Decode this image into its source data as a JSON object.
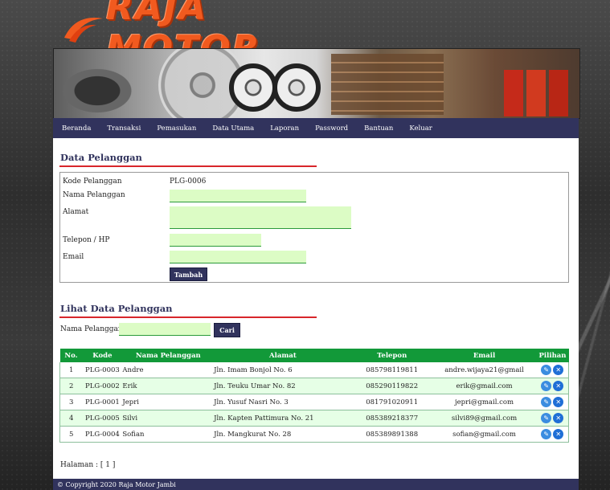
{
  "brand": {
    "logo_text": "RAJA MOTOR",
    "accent": "#f15a1f"
  },
  "nav": {
    "items": [
      "Beranda",
      "Transaksi",
      "Pemasukan",
      "Data Utama",
      "Laporan",
      "Password",
      "Bantuan",
      "Keluar"
    ]
  },
  "form": {
    "title": "Data Pelanggan",
    "kode_label": "Kode Pelanggan",
    "kode_value": "PLG-0006",
    "nama_label": "Nama Pelanggan",
    "nama_value": "",
    "alamat_label": "Alamat",
    "alamat_value": "",
    "telepon_label": "Telepon / HP",
    "telepon_value": "",
    "email_label": "Email",
    "email_value": "",
    "submit_label": "Tambah"
  },
  "list": {
    "title": "Lihat Data Pelanggan",
    "search_label": "Nama Pelanggan :",
    "search_value": "",
    "search_button": "Cari",
    "columns": [
      "No.",
      "Kode",
      "Nama Pelanggan",
      "Alamat",
      "Telepon",
      "Email",
      "Pilihan"
    ],
    "rows": [
      {
        "no": "1",
        "kode": "PLG-0003",
        "nama": "Andre",
        "alamat": "Jln. Imam Bonjol No. 6",
        "telepon": "085798119811",
        "email": "andre.wijaya21@gmail"
      },
      {
        "no": "2",
        "kode": "PLG-0002",
        "nama": "Erik",
        "alamat": "Jln. Teuku Umar No. 82",
        "telepon": "085290119822",
        "email": "erik@gmail.com"
      },
      {
        "no": "3",
        "kode": "PLG-0001",
        "nama": "Jepri",
        "alamat": "Jln. Yusuf Nasri No. 3",
        "telepon": "081791020911",
        "email": "jepri@gmail.com"
      },
      {
        "no": "4",
        "kode": "PLG-0005",
        "nama": "Silvi",
        "alamat": "Jln. Kapten Pattimura No. 21",
        "telepon": "085389218377",
        "email": "silvi89@gmail.com"
      },
      {
        "no": "5",
        "kode": "PLG-0004",
        "nama": "Sofian",
        "alamat": "Jln. Mangkurat No. 28",
        "telepon": "085389891388",
        "email": "sofian@gmail.com"
      }
    ],
    "pagination": "Halaman : [ 1 ]"
  },
  "footer": {
    "text": "© Copyright 2020 Raja Motor Jambi"
  },
  "colors": {
    "nav": "#31335d",
    "table_header": "#129939",
    "title_line": "#d8262b",
    "input_bg": "#dcfcc5"
  }
}
